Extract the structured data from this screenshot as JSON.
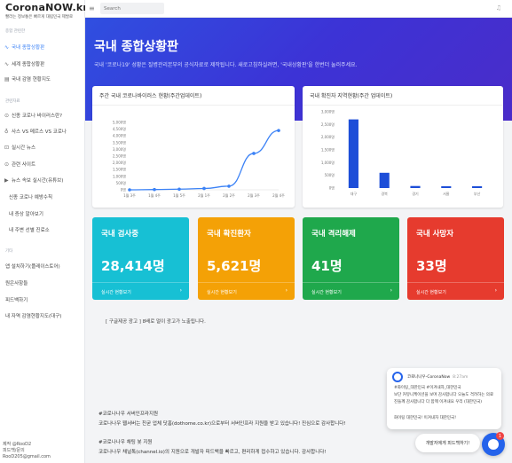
{
  "brand": {
    "title": "CoronaNOW.kr",
    "subtitle": "빨라는 정보통은 빠르게 대립민국 제발로"
  },
  "header": {
    "search_placeholder": "Search"
  },
  "sidebar": {
    "section1": "종합 관련한",
    "items1": [
      {
        "icon": "∿",
        "label": "국내 종합상황판"
      },
      {
        "icon": "∿",
        "label": "세계 종합상황판"
      },
      {
        "icon": "▤",
        "label": "국내 감염 현황지도"
      }
    ],
    "section2": "관련자료",
    "items2": [
      {
        "icon": "⊙",
        "label": "신종 코로나 바이러스란?"
      },
      {
        "icon": "♁",
        "label": "사스 VS 메르스 VS 코로나"
      },
      {
        "icon": "⊡",
        "label": "실시간 뉴스"
      },
      {
        "icon": "⊙",
        "label": "관련 사이트"
      },
      {
        "icon": "▶",
        "label": "뉴스 속보 실시간(유튜브)"
      },
      {
        "icon": "",
        "label": "신종 코로나 예방수칙"
      },
      {
        "icon": "",
        "label": "내 증상 알아보기"
      },
      {
        "icon": "",
        "label": "내 주변 선별 진료소"
      }
    ],
    "section3": "기타",
    "items3": [
      {
        "label": "앱 설치하기(플레이스토어)"
      },
      {
        "label": "원은사항들"
      },
      {
        "label": "피드백하기"
      },
      {
        "label": "내 자역 감염현황지도(대구)"
      }
    ],
    "footer": [
      "제작 @RooD2",
      "피드백/문의",
      "RooD205@gmail.com"
    ]
  },
  "hero": {
    "title": "국내 종합상황판",
    "description": "국내 '코로나19' 성황은 질병관리본부의 공식자료로 제작됩니다. 새로고침하실려면, '국내상황판'을 한번더 눌러주세요."
  },
  "line_card_title": "주간 국내 코로나바이러스 현황(주간업데이트)",
  "bar_card_title": "국내 확진자 지역현황(주간 업데이트)",
  "chart_data": [
    {
      "type": "line",
      "x": [
        "1월 3주",
        "1월 4주",
        "1월 5주",
        "2월 1주",
        "2월 2주",
        "2월 3주",
        "2월 4주"
      ],
      "values": [
        0,
        20,
        50,
        100,
        270,
        2700,
        4400
      ],
      "ylim": [
        0,
        5000
      ],
      "yticks": [
        "0명",
        "500명",
        "1,000명",
        "1,500명",
        "2,000명",
        "2,500명",
        "3,000명",
        "3,500명",
        "4,000명",
        "4,500명",
        "5,000명"
      ],
      "color": "#3b82f6",
      "grid": false
    },
    {
      "type": "bar",
      "categories": [
        "대구",
        "경북",
        "경기",
        "서울",
        "부산"
      ],
      "values": [
        2700,
        600,
        80,
        70,
        70
      ],
      "ylim": [
        0,
        3000
      ],
      "yticks": [
        "0명",
        "500명",
        "1,000명",
        "1,500명",
        "2,000명",
        "2,500명",
        "3,000명"
      ],
      "color": "#1d4ed8",
      "grid": false
    }
  ],
  "stats": [
    {
      "label": "국내 검사중",
      "value": "28,414명",
      "link": "실시간 현황보기",
      "color": "#17c0d4"
    },
    {
      "label": "국내 확진환자",
      "value": "5,621명",
      "link": "실시간 현황보기",
      "color": "#f4a106"
    },
    {
      "label": "국내 격리해제",
      "value": "41명",
      "link": "실시간 현황보기",
      "color": "#1fa84c"
    },
    {
      "label": "국내 사망자",
      "value": "33명",
      "link": "실시간 현황보기",
      "color": "#e63b2e"
    }
  ],
  "ad_text": "[ 구글제공 광고 ] 8배로 얼이 광고가 노출됩니다.",
  "info": {
    "server_head": "#코로나나우 서버인프라지원",
    "server_text": "코로나나우 웹서버는 친굳 업체 닷홈(dothome.co.kr)으로부터 서버인프라 지원을 받고 있습니다! 진심으로 감사합니다!",
    "channel_head": "#코로나나우 채팅 봇 지원",
    "channel_text": "코로나나우 채널톡(channel.io)의 지원으로 개발자 피드백을 빠르고, 편리하게 접수하고 있습니다. 감사합니다!"
  },
  "chat": {
    "sender": "코로나나우-CoronaNow",
    "time": "8:27am",
    "lines": [
      "#화이팅_대한민국 #이겨내자_대한민국",
      "보단 커뮤니케이션을 보며 감사합니다 오늘도 격려하는 의료",
      "진들께 감사합니다 다 함께 이겨내요 우리 (대한민국)",
      "",
      "화이팅 대한민국! 이겨내자 대한민국!"
    ],
    "button_label": "개발자에게 피드백하기!",
    "badge": "1"
  }
}
